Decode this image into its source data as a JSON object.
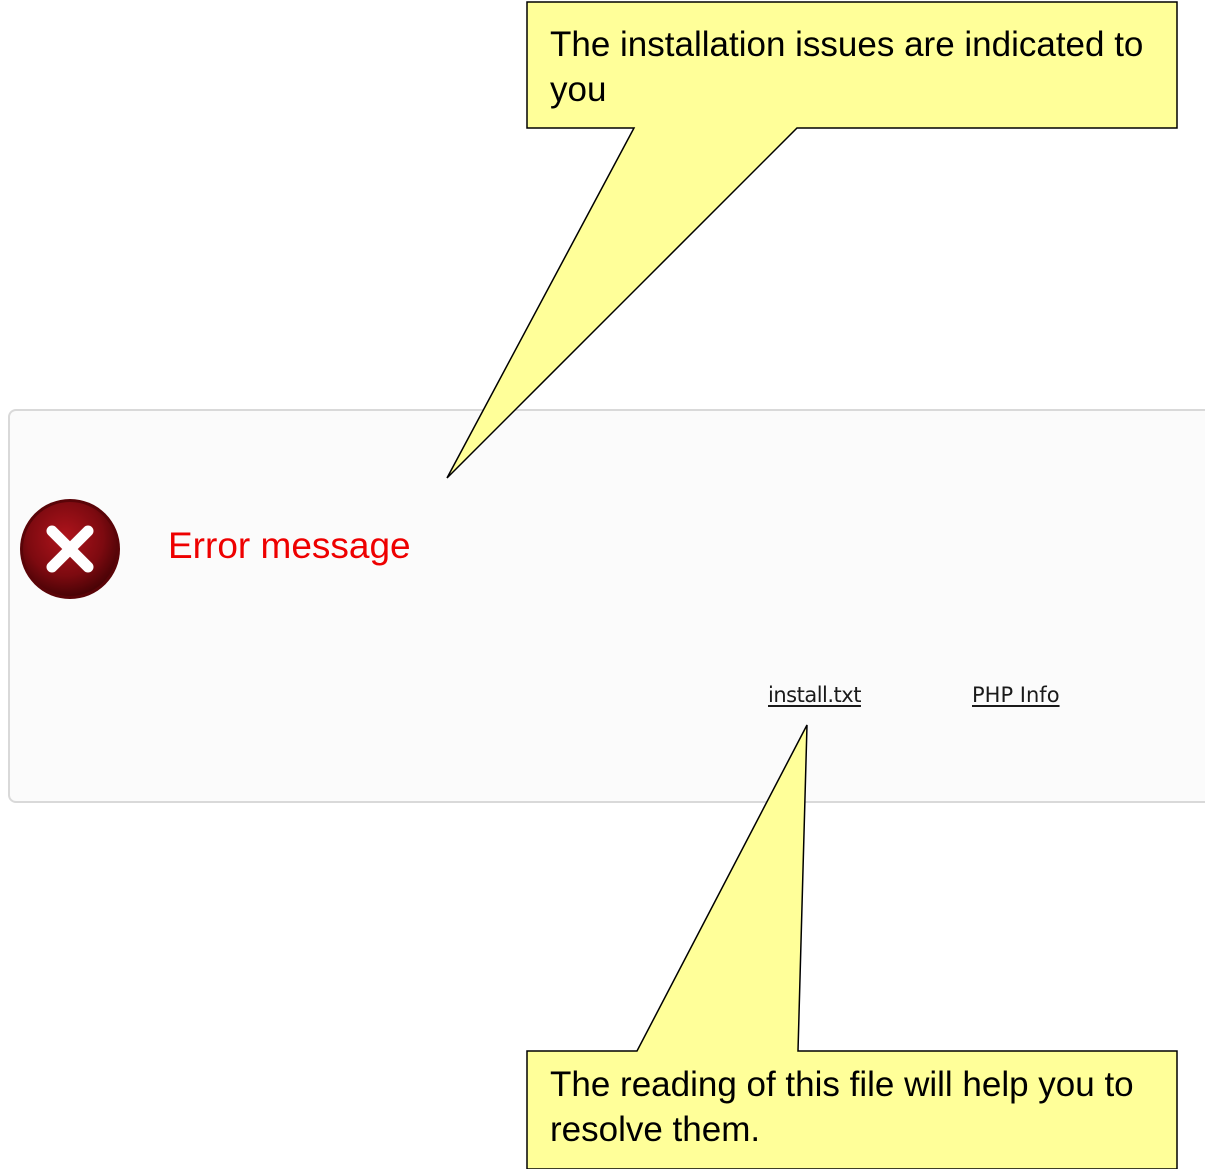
{
  "error_panel": {
    "icon": "error-x-circle-icon",
    "message": "Error message",
    "message_color": "#ee0000",
    "links": [
      {
        "label": "install.txt"
      },
      {
        "label": "PHP Info"
      }
    ]
  },
  "callouts": {
    "fill_color": "#ffff99",
    "top": {
      "text": "The installation issues are indicated to you"
    },
    "bottom": {
      "text": "The reading of this file will help you to resolve them."
    }
  }
}
